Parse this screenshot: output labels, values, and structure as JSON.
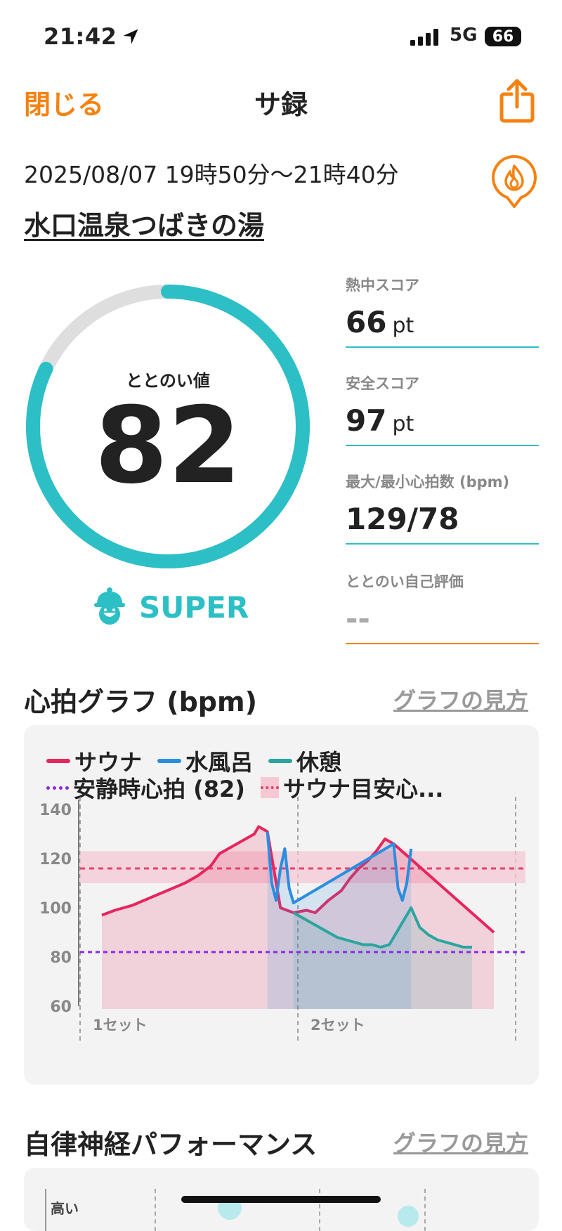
{
  "status_bar": {
    "time": "21:42",
    "network": "5G",
    "battery": "66"
  },
  "nav": {
    "close_label": "閉じる",
    "title": "サ録"
  },
  "session": {
    "date_range": "2025/08/07 19時50分〜21時40分",
    "venue": "水口温泉つばきの湯"
  },
  "score": {
    "label": "ととのい値",
    "value": "82",
    "progress": 0.82,
    "rank": "SUPER"
  },
  "stats": [
    {
      "label": "熱中スコア",
      "value": "66",
      "unit": "pt",
      "line_color": "#2cbfc6"
    },
    {
      "label": "安全スコア",
      "value": "97",
      "unit": "pt",
      "line_color": "#2cbfc6"
    },
    {
      "label": "最大/最小心拍数 (bpm)",
      "value": "129/78",
      "unit": "",
      "line_color": "#2cbfc6"
    },
    {
      "label": "ととのい自己評価",
      "value": "--",
      "unit": "",
      "line_color": "#f5820f"
    }
  ],
  "heart_graph": {
    "title": "心拍グラフ (bpm)",
    "link": "グラフの見方",
    "legend": {
      "sauna": "サウナ",
      "water": "水風呂",
      "rest": "休憩",
      "resting_hr": "安静時心拍 (82)",
      "target": "サウナ目安心..."
    },
    "y_ticks": [
      "140",
      "120",
      "100",
      "80",
      "60"
    ],
    "set_labels": [
      "1セット",
      "2セット"
    ]
  },
  "ans_section": {
    "title": "自律神経パフォーマンス",
    "link": "グラフの見方",
    "y_label": "高い"
  },
  "colors": {
    "accent": "#f5820f",
    "teal": "#2cbfc6",
    "sauna": "#e8255d",
    "water": "#2a8ee0",
    "rest": "#2aa5a0",
    "resting": "#8a2be2"
  },
  "chart_data": {
    "type": "line",
    "ylabel": "",
    "ylim": [
      60,
      140
    ],
    "y_ticks": [
      140,
      120,
      100,
      80,
      60
    ],
    "resting_hr": 82,
    "target_band": [
      110,
      123
    ],
    "target_line": 116,
    "series": [
      {
        "name": "サウナ",
        "color": "#e8255d",
        "points": [
          [
            5,
            97
          ],
          [
            8,
            99
          ],
          [
            12,
            101
          ],
          [
            16,
            104
          ],
          [
            20,
            107
          ],
          [
            24,
            110
          ],
          [
            27,
            113
          ],
          [
            30,
            117
          ],
          [
            32,
            122
          ],
          [
            34,
            124
          ],
          [
            36,
            126
          ],
          [
            38,
            128
          ],
          [
            40,
            130
          ],
          [
            41,
            133
          ],
          [
            43,
            131
          ],
          [
            46,
            100
          ],
          [
            49,
            98
          ],
          [
            52,
            99
          ],
          [
            54,
            98
          ],
          [
            57,
            103
          ],
          [
            60,
            107
          ],
          [
            62,
            112
          ],
          [
            64,
            116
          ],
          [
            66,
            119
          ],
          [
            68,
            123
          ],
          [
            70,
            128
          ],
          [
            72,
            126
          ],
          [
            95,
            90
          ]
        ]
      },
      {
        "name": "水風呂",
        "color": "#2a8ee0",
        "points": [
          [
            43,
            131
          ],
          [
            44,
            110
          ],
          [
            45,
            103
          ],
          [
            46,
            116
          ],
          [
            47,
            124
          ],
          [
            48,
            108
          ],
          [
            49,
            102
          ],
          [
            72,
            126
          ],
          [
            73,
            108
          ],
          [
            74,
            103
          ],
          [
            75,
            110
          ],
          [
            76,
            124
          ]
        ]
      },
      {
        "name": "休憩",
        "color": "#2aa5a0",
        "points": [
          [
            49,
            98
          ],
          [
            51,
            96
          ],
          [
            53,
            94
          ],
          [
            55,
            92
          ],
          [
            57,
            90
          ],
          [
            59,
            88
          ],
          [
            61,
            87
          ],
          [
            63,
            86
          ],
          [
            65,
            85
          ],
          [
            67,
            85
          ],
          [
            69,
            84
          ],
          [
            71,
            85
          ],
          [
            76,
            100
          ],
          [
            78,
            92
          ],
          [
            80,
            89
          ],
          [
            82,
            87
          ],
          [
            84,
            86
          ],
          [
            86,
            85
          ],
          [
            88,
            84
          ],
          [
            90,
            84
          ]
        ]
      }
    ],
    "transition": {
      "name": "",
      "color": "#888888"
    },
    "set_markers": [
      0,
      50,
      100
    ]
  }
}
